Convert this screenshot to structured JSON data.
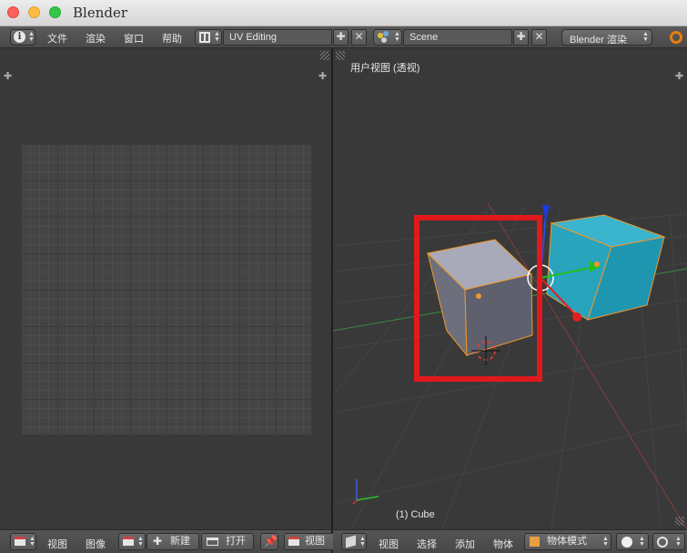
{
  "window": {
    "title": "Blender"
  },
  "topbar": {
    "menus": [
      "文件",
      "渲染",
      "窗口",
      "帮助"
    ],
    "screen_layout": "UV Editing",
    "scene": "Scene",
    "render_engine": "Blender 渲染"
  },
  "uv_editor": {
    "header": {
      "view": "视图",
      "image": "图像",
      "new": "新建",
      "open": "打开",
      "view2": "视图"
    }
  },
  "viewport": {
    "label": "用户视图 (透视)",
    "object_label": "(1) Cube",
    "header": {
      "view": "视图",
      "select": "选择",
      "add": "添加",
      "object": "物体",
      "mode": "物体模式"
    }
  },
  "colors": {
    "highlight_box": "#e0191d",
    "cube_selected": "#a8aab9",
    "cube_other": "#27a4bf",
    "select_outline": "#f0982a"
  }
}
